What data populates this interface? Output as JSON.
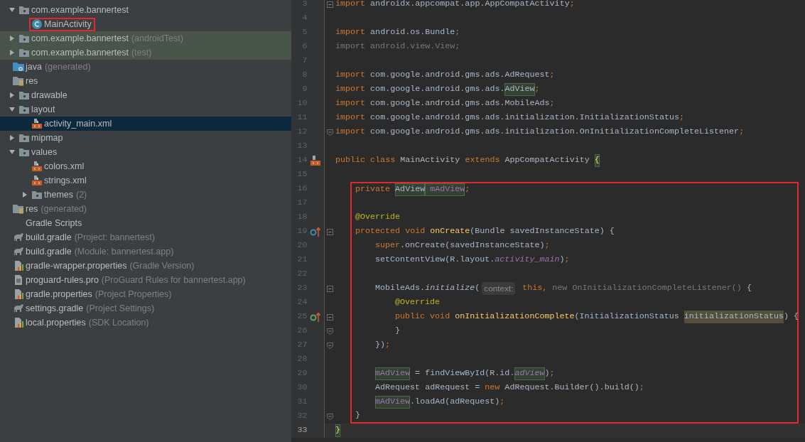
{
  "project_tree": {
    "package_items": [
      {
        "label": "com.example.bannertest",
        "kind": "package",
        "expanded": true,
        "selected": false,
        "children": [
          {
            "label": "MainActivity",
            "kind": "class",
            "selected": false,
            "framed": true
          }
        ]
      },
      {
        "label": "com.example.bannertest",
        "suffix": "(androidTest)",
        "kind": "package",
        "expanded": false,
        "selected": false,
        "test_scope": true
      },
      {
        "label": "com.example.bannertest",
        "suffix": "(test)",
        "kind": "package",
        "expanded": false,
        "selected": false,
        "test_scope": true
      }
    ],
    "module_items": [
      {
        "label": "java",
        "suffix": "(generated)",
        "kind": "generated-folder",
        "selected": false
      },
      {
        "label": "res",
        "kind": "res-folder",
        "selected": false,
        "children": [
          {
            "label": "drawable",
            "kind": "package",
            "expanded": false,
            "selected": false
          },
          {
            "label": "layout",
            "kind": "package",
            "expanded": true,
            "selected": false,
            "children": [
              {
                "label": "activity_main.xml",
                "kind": "xml",
                "selected": true
              }
            ]
          },
          {
            "label": "mipmap",
            "kind": "package",
            "expanded": false,
            "selected": false
          },
          {
            "label": "values",
            "kind": "package",
            "expanded": true,
            "selected": false,
            "children": [
              {
                "label": "colors.xml",
                "kind": "xml",
                "selected": false
              },
              {
                "label": "strings.xml",
                "kind": "xml",
                "selected": false
              },
              {
                "label": "themes",
                "suffix": "(2)",
                "kind": "package",
                "expanded": false,
                "selected": false
              }
            ]
          }
        ]
      },
      {
        "label": "res",
        "suffix": "(generated)",
        "kind": "res-folder",
        "selected": false
      }
    ],
    "project_items": [
      {
        "label": "Gradle Scripts",
        "selected": false,
        "children": [
          {
            "label": "build.gradle",
            "suffix": "(Project: bannertest)",
            "kind": "gradle",
            "selected": false
          },
          {
            "label": "build.gradle",
            "suffix": "(Module: bannertest.app)",
            "kind": "gradle",
            "selected": false
          },
          {
            "label": "gradle-wrapper.properties",
            "suffix": "(Gradle Version)",
            "kind": "properties",
            "selected": false
          },
          {
            "label": "proguard-rules.pro",
            "suffix": "(ProGuard Rules for bannertest.app)",
            "kind": "text",
            "selected": false
          },
          {
            "label": "gradle.properties",
            "suffix": "(Project Properties)",
            "kind": "properties",
            "selected": false
          },
          {
            "label": "settings.gradle",
            "suffix": "(Project Settings)",
            "kind": "gradle",
            "selected": false
          },
          {
            "label": "local.properties",
            "suffix": "(SDK Location)",
            "kind": "properties",
            "selected": false
          }
        ]
      }
    ]
  },
  "editor": {
    "lines": [
      {
        "number": "3",
        "fold_start": true,
        "tokens": [
          {
            "text": "import",
            "kind": "keyword"
          },
          {
            "text": " androidx.appcompat.app.AppCompatActivity",
            "kind": "plain"
          },
          {
            "text": ";",
            "kind": "keyword"
          }
        ]
      },
      {
        "number": "4"
      },
      {
        "number": "5",
        "tokens": [
          {
            "text": "import",
            "kind": "keyword"
          },
          {
            "text": " android.os.Bundle",
            "kind": "plain"
          },
          {
            "text": ";",
            "kind": "keyword"
          }
        ]
      },
      {
        "number": "6",
        "tokens": [
          {
            "text": "import android.view.View;",
            "kind": "unused"
          }
        ]
      },
      {
        "number": "7"
      },
      {
        "number": "8",
        "tokens": [
          {
            "text": "import",
            "kind": "keyword"
          },
          {
            "text": " com.google.android.gms.ads.AdRequest",
            "kind": "plain"
          },
          {
            "text": ";",
            "kind": "keyword"
          }
        ]
      },
      {
        "number": "9",
        "tokens": [
          {
            "text": "import",
            "kind": "keyword"
          },
          {
            "text": " com.google.android.gms.ads.",
            "kind": "plain"
          },
          {
            "text": "AdView",
            "kind": "plain",
            "highlighted": true
          },
          {
            "text": ";",
            "kind": "keyword"
          }
        ]
      },
      {
        "number": "10",
        "tokens": [
          {
            "text": "import",
            "kind": "keyword"
          },
          {
            "text": " com.google.android.gms.ads.MobileAds",
            "kind": "plain"
          },
          {
            "text": ";",
            "kind": "keyword"
          }
        ]
      },
      {
        "number": "11",
        "tokens": [
          {
            "text": "import",
            "kind": "keyword"
          },
          {
            "text": " com.google.android.gms.ads.initialization.InitializationStatus",
            "kind": "plain"
          },
          {
            "text": ";",
            "kind": "keyword"
          }
        ]
      },
      {
        "number": "12",
        "fold_end": true,
        "tokens": [
          {
            "text": "import",
            "kind": "keyword"
          },
          {
            "text": " com.google.android.gms.ads.initialization.OnInitializationCompleteListener",
            "kind": "plain"
          },
          {
            "text": ";",
            "kind": "keyword"
          }
        ]
      },
      {
        "number": "13"
      },
      {
        "number": "14",
        "gutter_marker": {
          "kind": "layout-file"
        },
        "tokens": [
          {
            "text": "public class",
            "kind": "keyword"
          },
          {
            "text": " MainActivity ",
            "kind": "plain"
          },
          {
            "text": "extends",
            "kind": "keyword"
          },
          {
            "text": " AppCompatActivity ",
            "kind": "plain"
          },
          {
            "text": "{",
            "kind": "brace",
            "highlighted": true
          }
        ],
        "children": [
          {
            "number": "15"
          },
          {
            "number": "16",
            "boxed": true,
            "tokens": [
              {
                "text": "private ",
                "kind": "keyword"
              },
              {
                "text": "AdView",
                "kind": "plain",
                "highlighted": true
              },
              {
                "text": " mAdView",
                "kind": "field",
                "highlighted": true
              },
              {
                "text": ";",
                "kind": "keyword"
              }
            ]
          },
          {
            "number": "17",
            "boxed": true
          },
          {
            "number": "18",
            "boxed": true,
            "tokens": [
              {
                "text": "@Override",
                "kind": "annotation"
              }
            ]
          },
          {
            "number": "19",
            "boxed": true,
            "fold_start": true,
            "gutter_marker": {
              "kind": "overrides"
            },
            "tokens": [
              {
                "text": "protected void ",
                "kind": "keyword"
              },
              {
                "text": "onCreate",
                "kind": "method"
              },
              {
                "text": "(Bundle savedInstanceState) {",
                "kind": "plain"
              }
            ],
            "children": [
              {
                "number": "20",
                "boxed": true,
                "tokens": [
                  {
                    "text": "super",
                    "kind": "keyword"
                  },
                  {
                    "text": ".onCreate(savedInstanceState)",
                    "kind": "plain"
                  },
                  {
                    "text": ";",
                    "kind": "keyword"
                  }
                ]
              },
              {
                "number": "21",
                "boxed": true,
                "tokens": [
                  {
                    "text": "setContentView(R.layout.",
                    "kind": "plain"
                  },
                  {
                    "text": "activity_main",
                    "kind": "static-field"
                  },
                  {
                    "text": ")",
                    "kind": "plain"
                  },
                  {
                    "text": ";",
                    "kind": "keyword"
                  }
                ]
              },
              {
                "number": "22",
                "boxed": true
              },
              {
                "number": "23",
                "boxed": true,
                "fold_start": true,
                "tokens": [
                  {
                    "text": "MobileAds.",
                    "kind": "plain"
                  },
                  {
                    "text": "initialize",
                    "kind": "static-call"
                  },
                  {
                    "text": "(",
                    "kind": "plain"
                  },
                  {
                    "text": "context:",
                    "kind": "hint"
                  },
                  {
                    "text": " this, ",
                    "kind": "keyword"
                  },
                  {
                    "text": "new OnInitializationCompleteListener()",
                    "kind": "unused"
                  },
                  {
                    "text": " {",
                    "kind": "plain"
                  }
                ],
                "children": [
                  {
                    "number": "24",
                    "boxed": true,
                    "tokens": [
                      {
                        "text": "@Override",
                        "kind": "annotation"
                      }
                    ]
                  },
                  {
                    "number": "25",
                    "boxed": true,
                    "fold_start": true,
                    "gutter_marker": {
                      "kind": "implements"
                    },
                    "tokens": [
                      {
                        "text": "public void ",
                        "kind": "keyword"
                      },
                      {
                        "text": "onInitializationComplete",
                        "kind": "method"
                      },
                      {
                        "text": "(InitializationStatus ",
                        "kind": "plain"
                      },
                      {
                        "text": "initializationStatus",
                        "kind": "unused-parameter"
                      },
                      {
                        "text": ") {",
                        "kind": "plain"
                      }
                    ]
                  },
                  {
                    "number": "26",
                    "boxed": true,
                    "fold_end": true,
                    "tokens": [
                      {
                        "text": "}",
                        "kind": "plain"
                      }
                    ]
                  }
                ]
              },
              {
                "number": "27",
                "boxed": true,
                "fold_end": true,
                "tokens": [
                  {
                    "text": "})",
                    "kind": "plain"
                  },
                  {
                    "text": ";",
                    "kind": "keyword"
                  }
                ]
              },
              {
                "number": "28",
                "boxed": true
              },
              {
                "number": "29",
                "boxed": true,
                "tokens": [
                  {
                    "text": "mAdView",
                    "kind": "field",
                    "highlighted": true
                  },
                  {
                    "text": " = findViewById(R.id.",
                    "kind": "plain"
                  },
                  {
                    "text": "adView",
                    "kind": "static-field",
                    "highlighted": true
                  },
                  {
                    "text": ")",
                    "kind": "plain"
                  },
                  {
                    "text": ";",
                    "kind": "keyword"
                  }
                ]
              },
              {
                "number": "30",
                "boxed": true,
                "tokens": [
                  {
                    "text": "AdRequest adRequest = ",
                    "kind": "plain"
                  },
                  {
                    "text": "new",
                    "kind": "keyword"
                  },
                  {
                    "text": " AdRequest.Builder().build()",
                    "kind": "plain"
                  },
                  {
                    "text": ";",
                    "kind": "keyword"
                  }
                ]
              },
              {
                "number": "31",
                "boxed": true,
                "tokens": [
                  {
                    "text": "mAdView",
                    "kind": "field",
                    "highlighted": true
                  },
                  {
                    "text": ".loadAd(adRequest)",
                    "kind": "plain"
                  },
                  {
                    "text": ";",
                    "kind": "keyword"
                  }
                ]
              }
            ]
          },
          {
            "number": "32",
            "boxed": true,
            "fold_end": true,
            "tokens": [
              {
                "text": "}",
                "kind": "plain"
              }
            ]
          }
        ]
      },
      {
        "number": "33",
        "current": true,
        "tokens": [
          {
            "text": "}",
            "kind": "brace",
            "highlighted": true
          }
        ]
      }
    ]
  }
}
